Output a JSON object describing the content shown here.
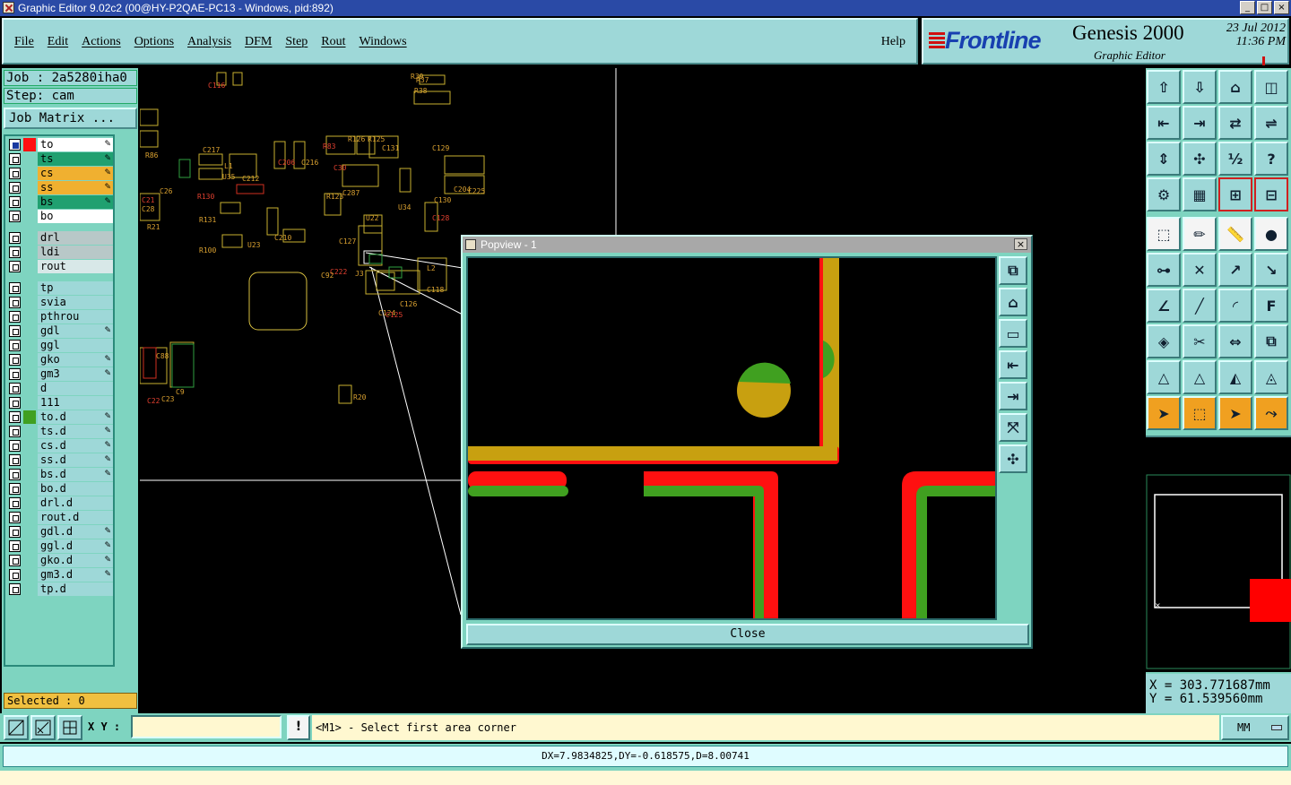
{
  "window": {
    "title": "Graphic Editor 9.02c2 (00@HY-P2QAE-PC13 - Windows, pid:892)",
    "buttons": [
      "_",
      "□",
      "×"
    ]
  },
  "menu": {
    "items": [
      "File",
      "Edit",
      "Actions",
      "Options",
      "Analysis",
      "DFM",
      "Step",
      "Rout",
      "Windows"
    ],
    "help": "Help"
  },
  "brand": {
    "logo": "Frontline",
    "product": "Genesis 2000",
    "subtitle": "Graphic Editor",
    "date": "23 Jul 2012",
    "time": "11:36 PM",
    "colors": {
      "logo": "#1840b0",
      "accent": "#d01010"
    }
  },
  "job": {
    "job_label": "Job : 2a5280iha0",
    "step_label": "Step: cam",
    "matrix_button": "Job Matrix ..."
  },
  "layers": [
    {
      "name": "to",
      "color": "#ffffff",
      "swatch": "#ff1010",
      "flag": "✎",
      "active": true
    },
    {
      "name": "ts",
      "color": "#20a070",
      "swatch": "",
      "flag": "✎"
    },
    {
      "name": "cs",
      "color": "#f0b030",
      "swatch": "",
      "flag": "✎"
    },
    {
      "name": "ss",
      "color": "#f0b030",
      "swatch": "",
      "flag": "✎"
    },
    {
      "name": "bs",
      "color": "#20a070",
      "swatch": "",
      "flag": "✎"
    },
    {
      "name": "bo",
      "color": "#ffffff",
      "swatch": "",
      "flag": ""
    },
    {
      "name": "drl",
      "color": "#b8c8c8",
      "swatch": "",
      "flag": ""
    },
    {
      "name": "ldi",
      "color": "#b8c8c8",
      "swatch": "",
      "flag": ""
    },
    {
      "name": "rout",
      "color": "#d8e8e8",
      "swatch": "",
      "flag": ""
    },
    {
      "name": "tp",
      "color": "#9ed8d8",
      "swatch": "",
      "flag": ""
    },
    {
      "name": "svia",
      "color": "#9ed8d8",
      "swatch": "",
      "flag": ""
    },
    {
      "name": "pthrou",
      "color": "#9ed8d8",
      "swatch": "",
      "flag": ""
    },
    {
      "name": "gdl",
      "color": "#9ed8d8",
      "swatch": "",
      "flag": "✎"
    },
    {
      "name": "ggl",
      "color": "#9ed8d8",
      "swatch": "",
      "flag": ""
    },
    {
      "name": "gko",
      "color": "#9ed8d8",
      "swatch": "",
      "flag": "✎"
    },
    {
      "name": "gm3",
      "color": "#9ed8d8",
      "swatch": "",
      "flag": "✎"
    },
    {
      "name": "d",
      "color": "#9ed8d8",
      "swatch": "",
      "flag": ""
    },
    {
      "name": "111",
      "color": "#9ed8d8",
      "swatch": "",
      "flag": ""
    },
    {
      "name": "to.d",
      "color": "#9ed8d8",
      "swatch": "#40a020",
      "flag": "✎"
    },
    {
      "name": "ts.d",
      "color": "#9ed8d8",
      "swatch": "",
      "flag": "✎"
    },
    {
      "name": "cs.d",
      "color": "#9ed8d8",
      "swatch": "",
      "flag": "✎"
    },
    {
      "name": "ss.d",
      "color": "#9ed8d8",
      "swatch": "",
      "flag": "✎"
    },
    {
      "name": "bs.d",
      "color": "#9ed8d8",
      "swatch": "",
      "flag": "✎"
    },
    {
      "name": "bo.d",
      "color": "#9ed8d8",
      "swatch": "",
      "flag": ""
    },
    {
      "name": "drl.d",
      "color": "#9ed8d8",
      "swatch": "",
      "flag": ""
    },
    {
      "name": "rout.d",
      "color": "#9ed8d8",
      "swatch": "",
      "flag": ""
    },
    {
      "name": "gdl.d",
      "color": "#9ed8d8",
      "swatch": "",
      "flag": "✎"
    },
    {
      "name": "ggl.d",
      "color": "#9ed8d8",
      "swatch": "",
      "flag": "✎"
    },
    {
      "name": "gko.d",
      "color": "#9ed8d8",
      "swatch": "",
      "flag": "✎"
    },
    {
      "name": "gm3.d",
      "color": "#9ed8d8",
      "swatch": "",
      "flag": "✎"
    },
    {
      "name": "tp.d",
      "color": "#9ed8d8",
      "swatch": "",
      "flag": ""
    }
  ],
  "selected": "Selected : 0",
  "canvas_labels": [
    "C116",
    "R38",
    "R39",
    "R37",
    "C217",
    "C206",
    "C216",
    "L1",
    "U35",
    "C212",
    "R130",
    "R131",
    "R100",
    "U23",
    "C210",
    "R83",
    "R126",
    "C131",
    "R125",
    "C129",
    "C30",
    "C287",
    "R123",
    "U22",
    "C127",
    "C128",
    "U34",
    "C130",
    "C204",
    "C225",
    "C222",
    "J3",
    "L2",
    "C118",
    "C124",
    "C125",
    "C126",
    "R86",
    "C28",
    "C26",
    "C22",
    "C23",
    "C9",
    "R20",
    "R21",
    "C21",
    "C88",
    "C92"
  ],
  "toolbar_icons": [
    "zoom-home-icon",
    "zoom-in-box-icon",
    "home-icon",
    "split-view-icon",
    "pan-left-icon",
    "pan-right-icon",
    "swap-icon",
    "snap-icon",
    "fit-vertical-icon",
    "fit-all-icon",
    "scale-1-2-icon",
    "help-query-icon",
    "settings-icon",
    "grid-icon",
    "layer-link-icon",
    "layer-link-alt-icon",
    "pad-icon",
    "net-icon",
    "ruler-icon",
    "circle-icon",
    "connect-icon",
    "delete-node-icon",
    "move-node-icon",
    "add-node-icon",
    "angle-icon",
    "line-icon",
    "arc-icon",
    "text-icon",
    "feature-pick-icon",
    "cut-icon",
    "measure-icon",
    "group-icon",
    "triangle-icon",
    "triangle-alt-icon",
    "triangle-box-icon",
    "triangle-cross-icon",
    "select-pointer-icon",
    "select-box-icon",
    "select-pointer-alt-icon",
    "route-icon"
  ],
  "coords": {
    "x": "X  = 303.771687mm",
    "y": "Y  = 61.539560mm"
  },
  "popview": {
    "title": "Popview - 1",
    "close_label": "Close"
  },
  "command": {
    "xy_label": "X Y :",
    "xy_value": "",
    "bang": "!",
    "prompt": "<M1> - Select first area corner",
    "units": "MM"
  },
  "measure": "DX=7.9834825,DY=-0.618575,D=8.00741"
}
